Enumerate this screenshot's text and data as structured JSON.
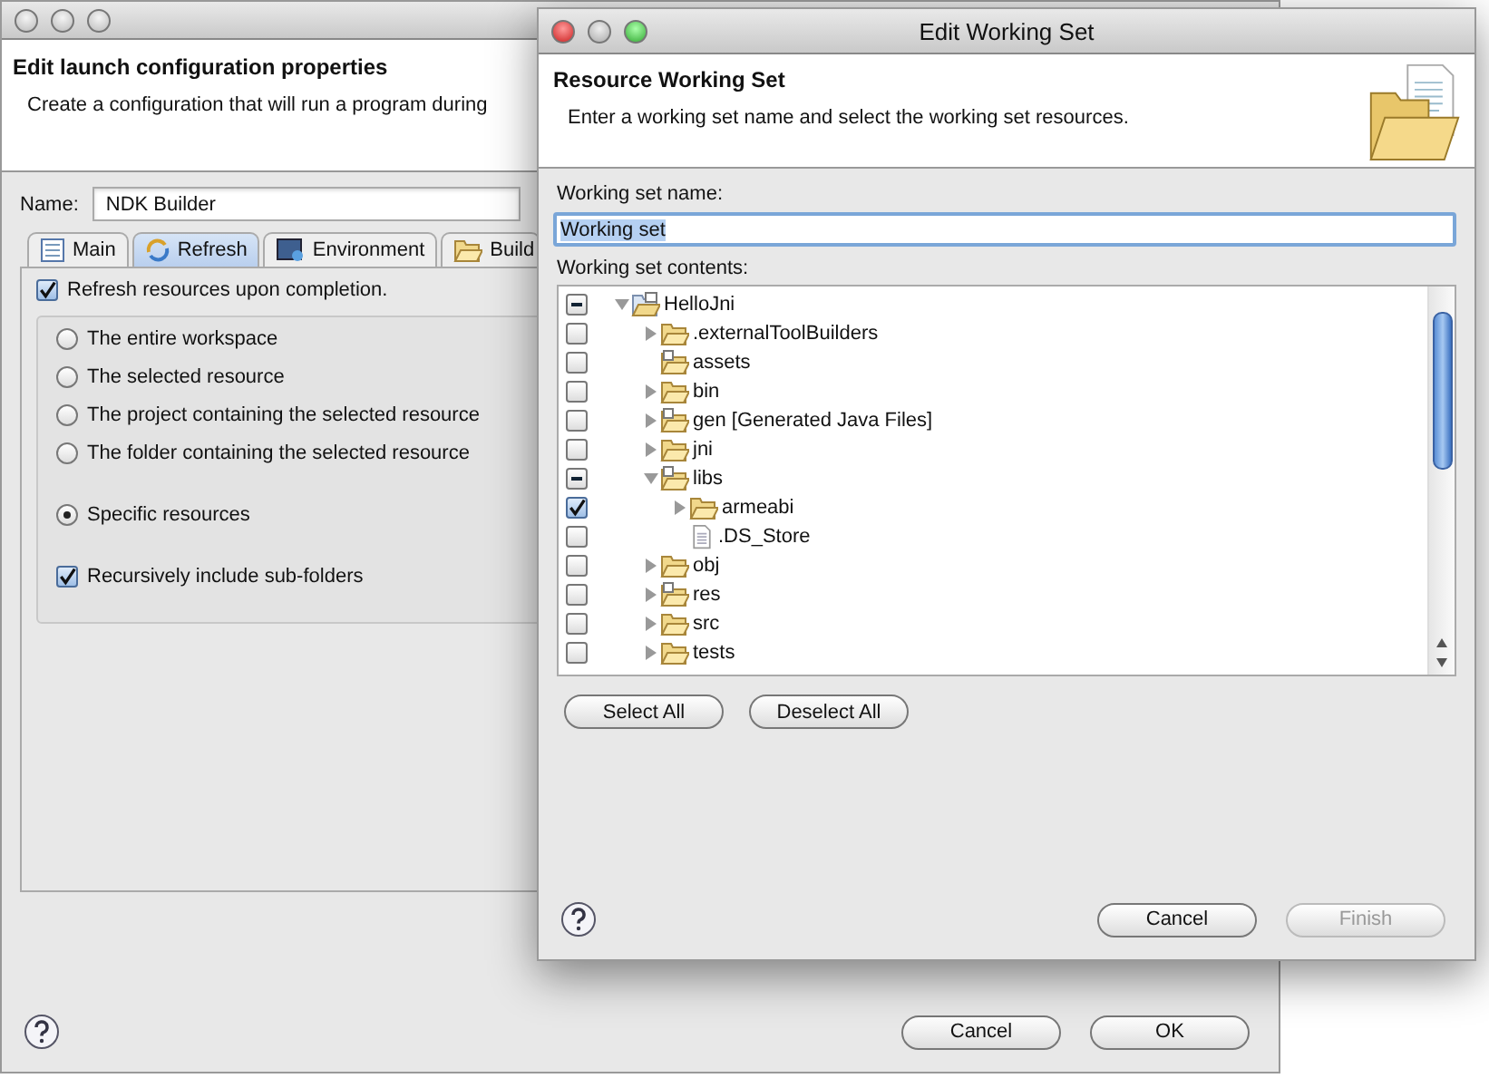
{
  "back_window": {
    "header": {
      "title": "Edit launch configuration properties",
      "description": "Create a configuration that will run a program during"
    },
    "name_label": "Name:",
    "name_value": "NDK Builder",
    "tabs": [
      {
        "label": "Main",
        "kind": "main",
        "selected": false
      },
      {
        "label": "Refresh",
        "kind": "refresh",
        "selected": true
      },
      {
        "label": "Environment",
        "kind": "environment",
        "selected": false
      },
      {
        "label": "Build",
        "kind": "build",
        "selected": false
      }
    ],
    "refresh_checkbox": {
      "label": "Refresh resources upon completion.",
      "checked": true
    },
    "scope_radios": [
      {
        "label": "The entire workspace",
        "selected": false
      },
      {
        "label": "The selected resource",
        "selected": false
      },
      {
        "label": "The project containing the selected resource",
        "selected": false
      },
      {
        "label": "The folder containing the selected resource",
        "selected": false
      },
      {
        "label": "Specific resources",
        "selected": true
      }
    ],
    "recursive_checkbox": {
      "label": "Recursively include sub-folders",
      "checked": true
    },
    "buttons": [
      {
        "label": "Cancel"
      },
      {
        "label": "OK"
      }
    ]
  },
  "dialog": {
    "title": "Edit Working Set",
    "header": {
      "title": "Resource Working Set",
      "description": "Enter a working set name and select the working set resources."
    },
    "name_label": "Working set name:",
    "name_value": "Working set",
    "name_text_selected": true,
    "contents_label": "Working set contents:",
    "tree": [
      {
        "label": "HelloJni",
        "kind": "project",
        "mixed": true,
        "expanded": true,
        "children": [
          {
            "label": ".externalToolBuilders",
            "kind": "folder",
            "checked": false,
            "mixed": false,
            "expanded": false
          },
          {
            "label": "assets",
            "kind": "source-folder",
            "checked": false,
            "mixed": false
          },
          {
            "label": "bin",
            "kind": "folder",
            "checked": false,
            "mixed": false,
            "expanded": false
          },
          {
            "label": "gen [Generated Java Files]",
            "kind": "source-folder",
            "checked": false,
            "mixed": false,
            "expanded": false
          },
          {
            "label": "jni",
            "kind": "folder",
            "checked": false,
            "mixed": false,
            "expanded": false
          },
          {
            "label": "libs",
            "kind": "source-folder",
            "mixed": true,
            "expanded": true,
            "children": [
              {
                "label": "armeabi",
                "kind": "folder",
                "checked": true,
                "expanded": false
              },
              {
                "label": ".DS_Store",
                "kind": "file",
                "checked": false,
                "mixed": false
              }
            ]
          },
          {
            "label": "obj",
            "kind": "folder",
            "checked": false,
            "mixed": false,
            "expanded": false
          },
          {
            "label": "res",
            "kind": "source-folder",
            "checked": false,
            "mixed": false,
            "expanded": false
          },
          {
            "label": "src",
            "kind": "folder",
            "checked": false,
            "mixed": false,
            "expanded": false
          },
          {
            "label": "tests",
            "kind": "folder",
            "checked": false,
            "mixed": false,
            "expanded": false
          }
        ]
      }
    ],
    "list_buttons": [
      {
        "label": "Select All"
      },
      {
        "label": "Deselect All"
      }
    ],
    "buttons": [
      {
        "label": "Cancel",
        "disabled": false
      },
      {
        "label": "Finish",
        "disabled": true
      }
    ]
  }
}
